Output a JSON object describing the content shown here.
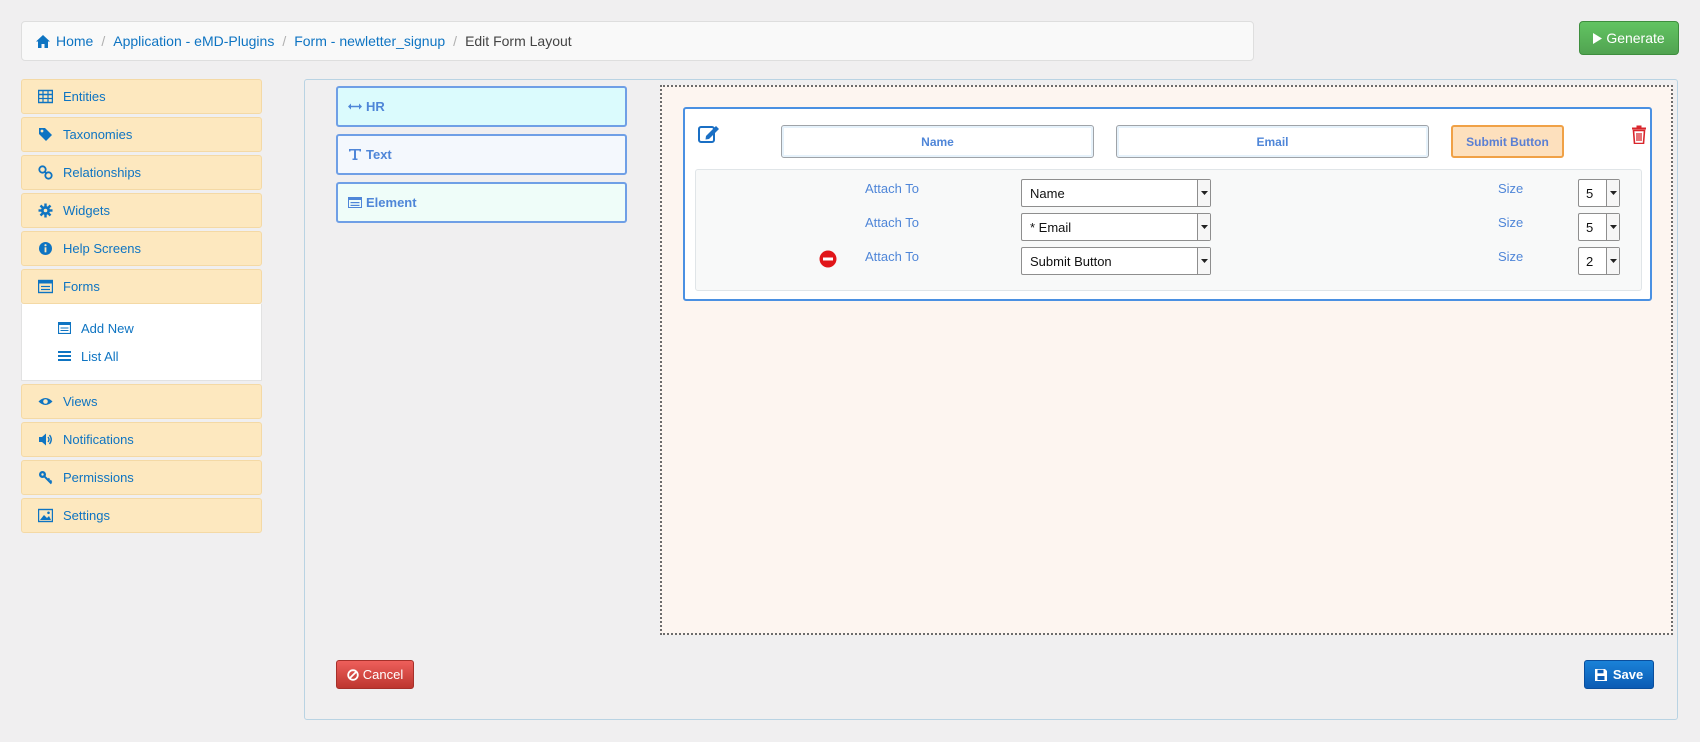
{
  "breadcrumb": {
    "items": [
      "Home",
      "Application - eMD-Plugins",
      "Form - newletter_signup"
    ],
    "current": "Edit Form Layout"
  },
  "header": {
    "generate_label": "Generate"
  },
  "sidebar": {
    "items": [
      {
        "label": "Entities",
        "icon": "table-icon"
      },
      {
        "label": "Taxonomies",
        "icon": "tag-icon"
      },
      {
        "label": "Relationships",
        "icon": "link-icon"
      },
      {
        "label": "Widgets",
        "icon": "gear-icon"
      },
      {
        "label": "Help Screens",
        "icon": "info-icon"
      },
      {
        "label": "Forms",
        "icon": "form-icon"
      },
      {
        "label": "Views",
        "icon": "eye-icon"
      },
      {
        "label": "Notifications",
        "icon": "volume-icon"
      },
      {
        "label": "Permissions",
        "icon": "key-icon"
      },
      {
        "label": "Settings",
        "icon": "image-icon"
      }
    ],
    "forms_sub": [
      {
        "label": "Add New",
        "icon": "form-icon"
      },
      {
        "label": "List All",
        "icon": "list-icon"
      }
    ]
  },
  "tools": {
    "hr": "HR",
    "text": "Text",
    "element": "Element"
  },
  "layout_row": {
    "chips": [
      "Name",
      "Email",
      "Submit Button"
    ],
    "attach_label": "Attach To",
    "size_label": "Size",
    "attachments": [
      {
        "field": "Name",
        "size": "5"
      },
      {
        "field": "* Email",
        "size": "5"
      },
      {
        "field": "Submit Button",
        "size": "2"
      }
    ]
  },
  "actions": {
    "cancel_label": "Cancel",
    "save_label": "Save"
  },
  "colors": {
    "accent": "#0e74c2",
    "sidebar_bg": "#fde8bf",
    "generate": "#51a351",
    "cancel": "#bd362f",
    "save": "#0b5bb4",
    "row_border": "#4a90e2"
  }
}
